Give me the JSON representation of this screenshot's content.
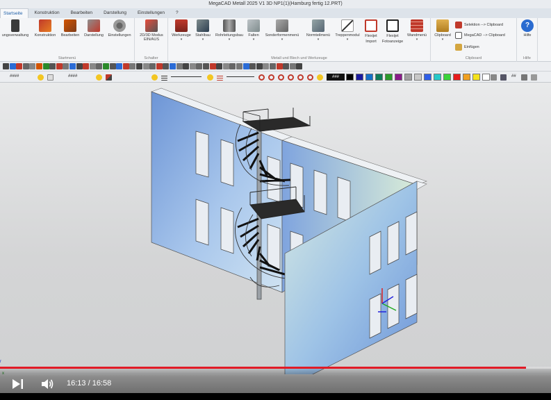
{
  "window": {
    "title": "MegaCAD Metall 2025 V1 3D NP1(1)(Hamburg fertig 12.PRT)"
  },
  "tabs": [
    {
      "label": "Startseite",
      "active": true
    },
    {
      "label": "Konstruktion",
      "active": false
    },
    {
      "label": "Bearbeiten",
      "active": false
    },
    {
      "label": "Darstellung",
      "active": false
    },
    {
      "label": "Einstellungen",
      "active": false
    },
    {
      "label": "?",
      "active": false
    }
  ],
  "ribbon": {
    "startmenu": {
      "label": "Startmenü",
      "buttons": [
        "ungsverwaltung",
        "Konstruktion",
        "Bearbeiten",
        "Darstellung",
        "Einstellungen"
      ]
    },
    "schalter": {
      "label": "Schalter",
      "button_line1": "2D/3D Modus",
      "button_line2": "EIN/AUS"
    },
    "metall": {
      "label": "Metall und Blech und Werkzeuge",
      "buttons": [
        "Werkzeuge",
        "Stahlbau",
        "Rohrleitungsbau",
        "Falten",
        "Sonderformenmenü",
        "Normteilmenü",
        "Treppenmodul",
        "Flexijet Import",
        "Flexijet Fotoanzeige",
        "Wandmenü"
      ]
    },
    "clipboard": {
      "label": "Clipboard",
      "button": "Clipboard",
      "line1": "Selektion --> Clipboard",
      "line2": "MegaCAD --> Clipboard",
      "line3": "Einfügen"
    },
    "hilfe": {
      "label": "Hilfe",
      "button": "Hilfe"
    }
  },
  "toolbar2": {
    "field1": "####",
    "field2": "####",
    "field3": "###",
    "colors": [
      "#000000",
      "#1a1aa0",
      "#1470c8",
      "#0e7b5a",
      "#2a9a2a",
      "#8a1a8a",
      "#a0a0a0",
      "#c8c8c8",
      "#2f5fe8",
      "#26c9c9",
      "#3ad43a",
      "#e81c1c",
      "#f0a020",
      "#f4e21c",
      "#ffffff"
    ]
  },
  "video": {
    "time": "16:13 / 16:58",
    "progress": 0.955
  },
  "accent": "#e21b26"
}
